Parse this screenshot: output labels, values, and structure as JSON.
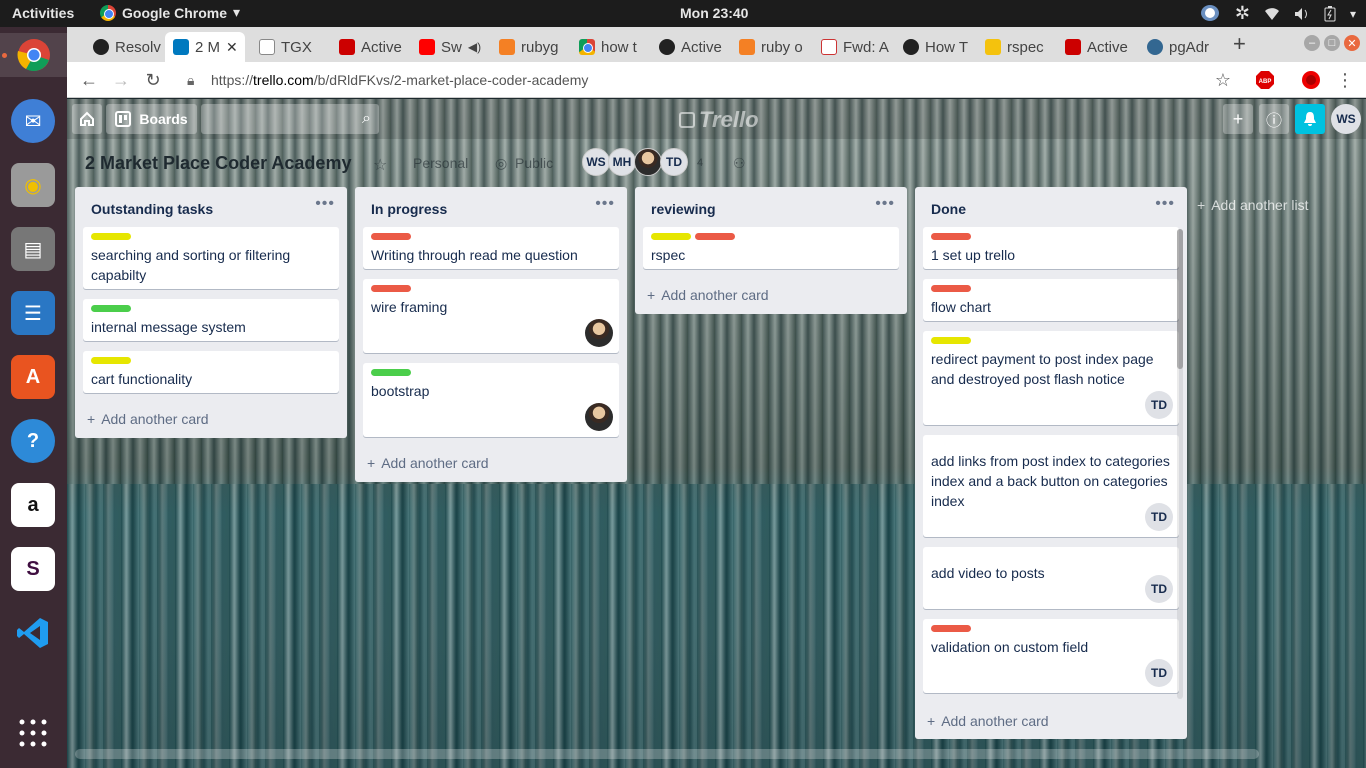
{
  "topbar": {
    "activities": "Activities",
    "app_name": "Google Chrome",
    "clock": "Mon 23:40"
  },
  "launcher": {
    "apps": [
      "chrome-icon",
      "thunderbird-icon",
      "rhythmbox-icon",
      "files-icon",
      "writer-icon",
      "software-icon",
      "help-icon",
      "amazon-icon",
      "slack-icon",
      "vscode-icon",
      "app-grid-icon"
    ]
  },
  "tabs": [
    {
      "label": "Resolv",
      "icon": "github-icon"
    },
    {
      "label": "2 M",
      "icon": "trello-icon",
      "active": true
    },
    {
      "label": "TGX",
      "icon": "page-icon"
    },
    {
      "label": "Active",
      "icon": "rails-icon"
    },
    {
      "label": "Sw",
      "icon": "youtube-icon"
    },
    {
      "label": "rubyg",
      "icon": "stackoverflow-icon"
    },
    {
      "label": "how t",
      "icon": "google-icon"
    },
    {
      "label": "Active",
      "icon": "github-icon"
    },
    {
      "label": "ruby o",
      "icon": "stackoverflow-icon"
    },
    {
      "label": "Fwd: A",
      "icon": "gmail-icon"
    },
    {
      "label": "How T",
      "icon": "github-icon"
    },
    {
      "label": "rspec",
      "icon": "bookmark-icon"
    },
    {
      "label": "Active",
      "icon": "rails-icon"
    },
    {
      "label": "pgAdr",
      "icon": "postgres-icon"
    }
  ],
  "address": {
    "scheme": "https://",
    "host": "trello.com",
    "path": "/b/dRldFKvs/2-market-place-coder-academy"
  },
  "trello": {
    "boards_label": "Boards",
    "logo": "Trello",
    "header_avatar": "WS",
    "board_name": "2 Market Place Coder Academy",
    "team": "Personal",
    "visibility": "Public",
    "members": [
      "WS",
      "MH",
      "",
      "TD"
    ],
    "member_more": "4",
    "add_list": "Add another list",
    "add_card": "Add another card"
  },
  "colors": {
    "yellow": "#e6e600",
    "red": "#eb5a46",
    "green": "#4bce4b",
    "notify": "#00c2e0"
  },
  "lists": [
    {
      "title": "Outstanding tasks",
      "cards": [
        {
          "labels": [
            "yellow"
          ],
          "text": "searching and sorting or filtering capabilty"
        },
        {
          "labels": [
            "green"
          ],
          "text": "internal message system"
        },
        {
          "labels": [
            "yellow"
          ],
          "text": "cart functionality"
        }
      ]
    },
    {
      "title": "In progress",
      "cards": [
        {
          "labels": [
            "red"
          ],
          "text": "Writing through read me question"
        },
        {
          "labels": [
            "red"
          ],
          "text": "wire framing",
          "avatar": "photo"
        },
        {
          "labels": [
            "green"
          ],
          "text": "bootstrap",
          "avatar": "photo"
        }
      ]
    },
    {
      "title": "reviewing",
      "cards": [
        {
          "labels": [
            "yellow",
            "red"
          ],
          "text": "rspec"
        }
      ]
    },
    {
      "title": "Done",
      "cards": [
        {
          "labels": [
            "red"
          ],
          "text": "1 set up trello"
        },
        {
          "labels": [
            "red"
          ],
          "text": "flow chart"
        },
        {
          "labels": [
            "yellow"
          ],
          "text": "redirect payment to post index page and destroyed post flash notice",
          "avatar": "TD"
        },
        {
          "labels": [],
          "text": "add links from post index to categories index and a back button on categories index",
          "avatar": "TD"
        },
        {
          "labels": [],
          "text": "add video to posts",
          "avatar": "TD"
        },
        {
          "labels": [
            "red"
          ],
          "text": "validation on custom field",
          "avatar": "TD"
        }
      ]
    }
  ]
}
